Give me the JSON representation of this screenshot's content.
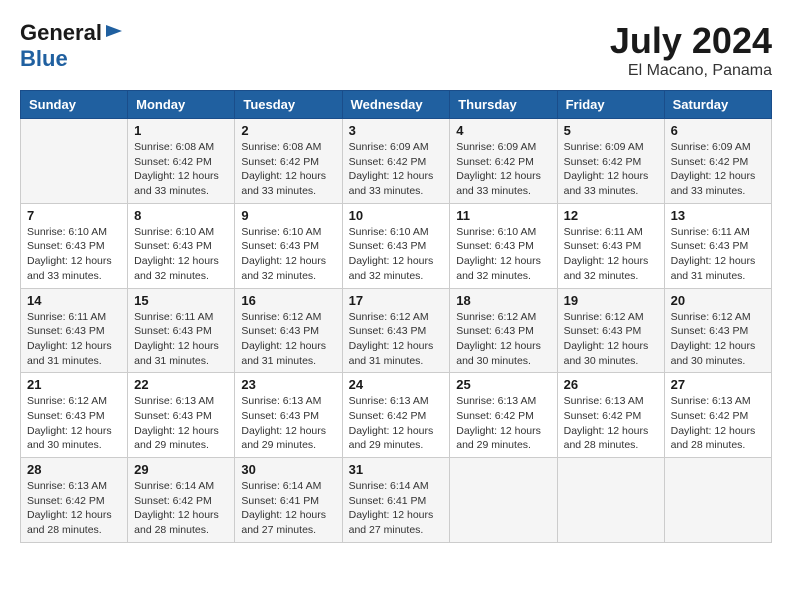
{
  "header": {
    "logo_general": "General",
    "logo_blue": "Blue",
    "month_title": "July 2024",
    "location": "El Macano, Panama"
  },
  "days_of_week": [
    "Sunday",
    "Monday",
    "Tuesday",
    "Wednesday",
    "Thursday",
    "Friday",
    "Saturday"
  ],
  "weeks": [
    [
      {
        "day": "",
        "info": ""
      },
      {
        "day": "1",
        "info": "Sunrise: 6:08 AM\nSunset: 6:42 PM\nDaylight: 12 hours\nand 33 minutes."
      },
      {
        "day": "2",
        "info": "Sunrise: 6:08 AM\nSunset: 6:42 PM\nDaylight: 12 hours\nand 33 minutes."
      },
      {
        "day": "3",
        "info": "Sunrise: 6:09 AM\nSunset: 6:42 PM\nDaylight: 12 hours\nand 33 minutes."
      },
      {
        "day": "4",
        "info": "Sunrise: 6:09 AM\nSunset: 6:42 PM\nDaylight: 12 hours\nand 33 minutes."
      },
      {
        "day": "5",
        "info": "Sunrise: 6:09 AM\nSunset: 6:42 PM\nDaylight: 12 hours\nand 33 minutes."
      },
      {
        "day": "6",
        "info": "Sunrise: 6:09 AM\nSunset: 6:42 PM\nDaylight: 12 hours\nand 33 minutes."
      }
    ],
    [
      {
        "day": "7",
        "info": "Sunrise: 6:10 AM\nSunset: 6:43 PM\nDaylight: 12 hours\nand 33 minutes."
      },
      {
        "day": "8",
        "info": "Sunrise: 6:10 AM\nSunset: 6:43 PM\nDaylight: 12 hours\nand 32 minutes."
      },
      {
        "day": "9",
        "info": "Sunrise: 6:10 AM\nSunset: 6:43 PM\nDaylight: 12 hours\nand 32 minutes."
      },
      {
        "day": "10",
        "info": "Sunrise: 6:10 AM\nSunset: 6:43 PM\nDaylight: 12 hours\nand 32 minutes."
      },
      {
        "day": "11",
        "info": "Sunrise: 6:10 AM\nSunset: 6:43 PM\nDaylight: 12 hours\nand 32 minutes."
      },
      {
        "day": "12",
        "info": "Sunrise: 6:11 AM\nSunset: 6:43 PM\nDaylight: 12 hours\nand 32 minutes."
      },
      {
        "day": "13",
        "info": "Sunrise: 6:11 AM\nSunset: 6:43 PM\nDaylight: 12 hours\nand 31 minutes."
      }
    ],
    [
      {
        "day": "14",
        "info": "Sunrise: 6:11 AM\nSunset: 6:43 PM\nDaylight: 12 hours\nand 31 minutes."
      },
      {
        "day": "15",
        "info": "Sunrise: 6:11 AM\nSunset: 6:43 PM\nDaylight: 12 hours\nand 31 minutes."
      },
      {
        "day": "16",
        "info": "Sunrise: 6:12 AM\nSunset: 6:43 PM\nDaylight: 12 hours\nand 31 minutes."
      },
      {
        "day": "17",
        "info": "Sunrise: 6:12 AM\nSunset: 6:43 PM\nDaylight: 12 hours\nand 31 minutes."
      },
      {
        "day": "18",
        "info": "Sunrise: 6:12 AM\nSunset: 6:43 PM\nDaylight: 12 hours\nand 30 minutes."
      },
      {
        "day": "19",
        "info": "Sunrise: 6:12 AM\nSunset: 6:43 PM\nDaylight: 12 hours\nand 30 minutes."
      },
      {
        "day": "20",
        "info": "Sunrise: 6:12 AM\nSunset: 6:43 PM\nDaylight: 12 hours\nand 30 minutes."
      }
    ],
    [
      {
        "day": "21",
        "info": "Sunrise: 6:12 AM\nSunset: 6:43 PM\nDaylight: 12 hours\nand 30 minutes."
      },
      {
        "day": "22",
        "info": "Sunrise: 6:13 AM\nSunset: 6:43 PM\nDaylight: 12 hours\nand 29 minutes."
      },
      {
        "day": "23",
        "info": "Sunrise: 6:13 AM\nSunset: 6:43 PM\nDaylight: 12 hours\nand 29 minutes."
      },
      {
        "day": "24",
        "info": "Sunrise: 6:13 AM\nSunset: 6:42 PM\nDaylight: 12 hours\nand 29 minutes."
      },
      {
        "day": "25",
        "info": "Sunrise: 6:13 AM\nSunset: 6:42 PM\nDaylight: 12 hours\nand 29 minutes."
      },
      {
        "day": "26",
        "info": "Sunrise: 6:13 AM\nSunset: 6:42 PM\nDaylight: 12 hours\nand 28 minutes."
      },
      {
        "day": "27",
        "info": "Sunrise: 6:13 AM\nSunset: 6:42 PM\nDaylight: 12 hours\nand 28 minutes."
      }
    ],
    [
      {
        "day": "28",
        "info": "Sunrise: 6:13 AM\nSunset: 6:42 PM\nDaylight: 12 hours\nand 28 minutes."
      },
      {
        "day": "29",
        "info": "Sunrise: 6:14 AM\nSunset: 6:42 PM\nDaylight: 12 hours\nand 28 minutes."
      },
      {
        "day": "30",
        "info": "Sunrise: 6:14 AM\nSunset: 6:41 PM\nDaylight: 12 hours\nand 27 minutes."
      },
      {
        "day": "31",
        "info": "Sunrise: 6:14 AM\nSunset: 6:41 PM\nDaylight: 12 hours\nand 27 minutes."
      },
      {
        "day": "",
        "info": ""
      },
      {
        "day": "",
        "info": ""
      },
      {
        "day": "",
        "info": ""
      }
    ]
  ]
}
